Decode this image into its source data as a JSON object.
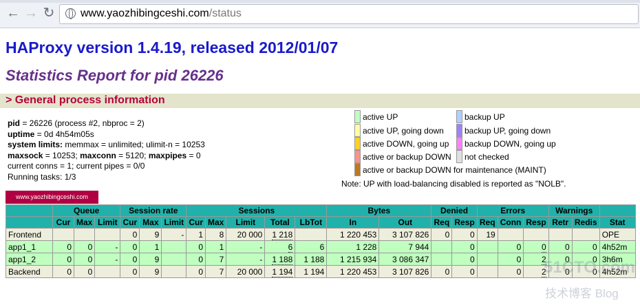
{
  "browser": {
    "url_host": "www.yaozhibingceshi.com",
    "url_path": "/status",
    "back_icon": "back-arrow-icon",
    "forward_icon": "forward-arrow-icon",
    "reload_icon": "reload-icon",
    "site_icon": "globe-icon"
  },
  "page": {
    "title": "HAProxy version 1.4.19, released 2012/01/07",
    "subtitle": "Statistics Report for pid 26226",
    "section": "> General process information"
  },
  "process": {
    "pid_label": "pid",
    "pid_value": " = 26226 (process #2, nbproc = 2)",
    "uptime_label": "uptime",
    "uptime_value": " = 0d 4h54m05s",
    "limits_label": "system limits:",
    "limits_value": " memmax = unlimited; ulimit-n = 10253",
    "maxsock_label": "maxsock",
    "maxsock_value": " = 10253; ",
    "maxconn_label": "maxconn",
    "maxconn_value": " = 5120; ",
    "maxpipes_label": "maxpipes",
    "maxpipes_value": " = 0",
    "conns_line": "current conns = 1; current pipes = 0/0",
    "tasks_line": "Running tasks: 1/3"
  },
  "legend": {
    "items_left": [
      {
        "label": "active UP",
        "color": "#c0ffc0"
      },
      {
        "label": "active UP, going down",
        "color": "#ffffa0"
      },
      {
        "label": "active DOWN, going up",
        "color": "#ffd020"
      },
      {
        "label": "active or backup DOWN",
        "color": "#ff9090"
      },
      {
        "label": "active or backup DOWN for maintenance (MAINT)",
        "color": "#c07820"
      }
    ],
    "items_right": [
      {
        "label": "backup UP",
        "color": "#b0d0ff"
      },
      {
        "label": "backup UP, going down",
        "color": "#a080ff"
      },
      {
        "label": "backup DOWN, going up",
        "color": "#ff80ff"
      },
      {
        "label": "not checked",
        "color": "#e0e0e0"
      }
    ],
    "note": "Note: UP with load-balancing disabled is reported as \"NOLB\"."
  },
  "proxy_name": "www.yaozhibingceshi.com",
  "table": {
    "groups": [
      "Queue",
      "Session rate",
      "Sessions",
      "Bytes",
      "Denied",
      "Errors",
      "Warnings"
    ],
    "sub": {
      "queue": [
        "Cur",
        "Max",
        "Limit"
      ],
      "rate": [
        "Cur",
        "Max",
        "Limit"
      ],
      "sessions": [
        "Cur",
        "Max",
        "Limit",
        "Total",
        "LbTot"
      ],
      "bytes": [
        "In",
        "Out"
      ],
      "denied": [
        "Req",
        "Resp"
      ],
      "errors": [
        "Req",
        "Conn",
        "Resp"
      ],
      "warnings": [
        "Retr",
        "Redis"
      ],
      "status": "Stat"
    },
    "rows": [
      {
        "name": "Frontend",
        "kind": "fe",
        "cells": [
          "",
          "",
          "",
          "0",
          "9",
          "-",
          "1",
          "8",
          "20 000",
          "1 218",
          "",
          "1 220 453",
          "3 107 826",
          "0",
          "0",
          "19",
          "",
          "",
          "",
          "",
          "OPE"
        ]
      },
      {
        "name": "app1_1",
        "kind": "sv",
        "cells": [
          "0",
          "0",
          "-",
          "0",
          "1",
          "",
          "0",
          "1",
          "-",
          "6",
          "6",
          "1 228",
          "7 944",
          "",
          "0",
          "",
          "0",
          "0",
          "0",
          "0",
          "4h52m"
        ]
      },
      {
        "name": "app1_2",
        "kind": "sv",
        "cells": [
          "0",
          "0",
          "-",
          "0",
          "9",
          "",
          "0",
          "7",
          "-",
          "1 188",
          "1 188",
          "1 215 934",
          "3 086 347",
          "",
          "0",
          "",
          "0",
          "2",
          "0",
          "0",
          "3h6m"
        ]
      },
      {
        "name": "Backend",
        "kind": "be",
        "cells": [
          "0",
          "0",
          "",
          "0",
          "9",
          "",
          "0",
          "7",
          "20 000",
          "1 194",
          "1 194",
          "1 220 453",
          "3 107 826",
          "0",
          "0",
          "",
          "0",
          "2",
          "0",
          "0",
          "4h52m"
        ]
      }
    ]
  },
  "watermark": {
    "line1": "51CTO.com",
    "line2": "技术博客  Blog"
  }
}
